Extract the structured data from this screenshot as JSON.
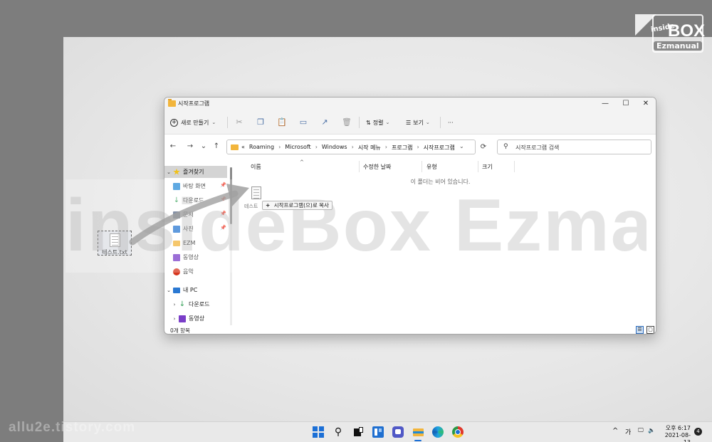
{
  "brand": {
    "logo_top": "inside",
    "logo_main": "BOX",
    "logo_sub": "Ezmanual",
    "watermark": "insideBox Ezmanual",
    "site": "allu2e.tistory.com"
  },
  "desktop": {
    "file_label": "테스트.txt"
  },
  "window": {
    "title": "시작프로그램",
    "minimize": "—",
    "maximize": "☐",
    "close": "✕",
    "toolbar": {
      "new_label": "새로 만들기",
      "sort_label": "정렬",
      "view_label": "보기",
      "more_label": "···"
    },
    "nav": {
      "back": "←",
      "forward": "→",
      "recent": "⌄",
      "up": "↑",
      "refresh": "⟳"
    },
    "address": {
      "prefix": "«",
      "crumbs": [
        "Roaming",
        "Microsoft",
        "Windows",
        "시작 메뉴",
        "프로그램",
        "시작프로그램"
      ],
      "separator": "›"
    },
    "search_placeholder": "시작프로그램 검색",
    "sidebar": [
      {
        "label": "즐겨찾기",
        "icon": "star-icon",
        "color": "#f1c21b"
      },
      {
        "label": "바탕 화면",
        "icon": "desktop-icon",
        "color": "#2a8dd8"
      },
      {
        "label": "다운로드",
        "icon": "download-icon",
        "color": "#2e9e53"
      },
      {
        "label": "문서",
        "icon": "document-icon",
        "color": "#5a6b88"
      },
      {
        "label": "사진",
        "icon": "pictures-icon",
        "color": "#2a78d2"
      },
      {
        "label": "EZM",
        "icon": "folder-icon",
        "color": "#f2b53b"
      },
      {
        "label": "동영상",
        "icon": "videos-icon",
        "color": "#7a3ec8"
      },
      {
        "label": "음악",
        "icon": "music-icon",
        "color": "#d6361e"
      },
      {
        "label": "내 PC",
        "icon": "pc-icon",
        "color": "#2a78d2"
      },
      {
        "label": "다운로드",
        "icon": "download-icon",
        "color": "#2e9e53"
      },
      {
        "label": "동영상",
        "icon": "videos-icon",
        "color": "#7a3ec8"
      }
    ],
    "columns": [
      "이름",
      "수정한 날짜",
      "유형",
      "크기"
    ],
    "empty_message": "이 폴더는 비어 있습니다.",
    "drag": {
      "file_label": "테스트",
      "tooltip_plus": "+",
      "tooltip_text": "시작프로그램(으)로 복사"
    },
    "status": "0개 항목"
  },
  "taskbar": {
    "apps": [
      "start-icon",
      "search-icon",
      "task-view-icon",
      "widgets-icon",
      "teams-chat-icon",
      "file-explorer-icon",
      "edge-icon",
      "chrome-icon"
    ],
    "tray_caret": "^",
    "ime": "가",
    "clock_time": "오후 6:17",
    "clock_date": "2021-08-13",
    "notifications": "4"
  }
}
